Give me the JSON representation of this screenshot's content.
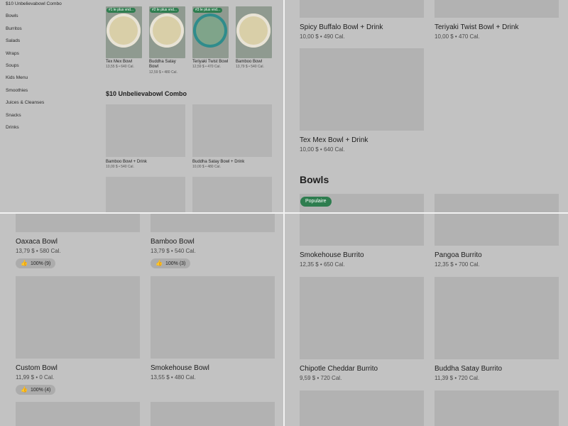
{
  "sidebar": {
    "items": [
      {
        "label": "$10 Unbelievabowl Combo"
      },
      {
        "label": "Bowls"
      },
      {
        "label": "Burritos"
      },
      {
        "label": "Salads"
      },
      {
        "label": "Wraps"
      },
      {
        "label": "Soups"
      },
      {
        "label": "Kids Menu"
      },
      {
        "label": "Smoothies"
      },
      {
        "label": "Juices & Cleanses"
      },
      {
        "label": "Snacks"
      },
      {
        "label": "Drinks"
      }
    ]
  },
  "featured": [
    {
      "badge": "#1 le plus vnd...",
      "name": "Tex Mex Bowl",
      "meta": "13,55 $ • 640 Cal."
    },
    {
      "badge": "#2 le plus vnd...",
      "name": "Buddha Satay Bowl",
      "meta": "12,59 $ • 480 Cal."
    },
    {
      "badge": "#3 le plus vnd...",
      "name": "Teriyaki Twist Bowl",
      "meta": "12,59 $ • 470 Cal."
    },
    {
      "badge": "",
      "name": "Bamboo Bowl",
      "meta": "13,79 $ • 540 Cal."
    }
  ],
  "combo_section": {
    "title": "$10 Unbelievabowl Combo",
    "items": [
      {
        "name": "Bamboo Bowl + Drink",
        "meta": "10,00 $ • 540 Cal."
      },
      {
        "name": "Buddha Satay Bowl + Drink",
        "meta": "10,00 $ • 480 Cal."
      }
    ]
  },
  "q2": {
    "items": [
      {
        "name": "Spicy Buffalo Bowl + Drink",
        "meta": "10,00 $ • 490 Cal."
      },
      {
        "name": "Teriyaki Twist Bowl + Drink",
        "meta": "10,00 $ • 470 Cal."
      },
      {
        "name": "Tex Mex Bowl + Drink",
        "meta": "10,00 $ • 640 Cal."
      }
    ],
    "bowls_title": "Bowls",
    "popular_badge": "Populaire"
  },
  "q3": {
    "items": [
      {
        "name": "Oaxaca Bowl",
        "meta": "13,79 $ • 580 Cal.",
        "rating": "100% (9)"
      },
      {
        "name": "Bamboo Bowl",
        "meta": "13,79 $ • 540 Cal.",
        "rating": "100% (3)"
      },
      {
        "name": "Custom Bowl",
        "meta": "11,99 $ • 0 Cal.",
        "rating": "100% (4)"
      },
      {
        "name": "Smokehouse Bowl",
        "meta": "13,55 $ • 480 Cal.",
        "rating": ""
      }
    ]
  },
  "q4": {
    "items": [
      {
        "name": "Smokehouse Burrito",
        "meta": "12,35 $ • 650 Cal."
      },
      {
        "name": "Pangoa Burrito",
        "meta": "12,35 $ • 700 Cal."
      },
      {
        "name": "Chipotle Cheddar Burrito",
        "meta": "9,59 $ • 720 Cal."
      },
      {
        "name": "Buddha Satay Burrito",
        "meta": "11,39 $ • 720 Cal."
      }
    ]
  },
  "icons": {
    "thumb": "thumbs-up-icon"
  },
  "colors": {
    "badge_green": "#2e7d4f",
    "overlay_gray": "#c2c2c2",
    "divider": "#f2f2f2"
  }
}
